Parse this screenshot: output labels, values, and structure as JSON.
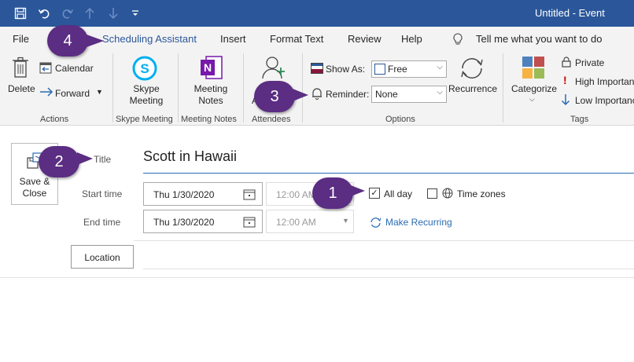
{
  "window": {
    "title": "Untitled  -  Event"
  },
  "quick_access": {
    "save_icon": "save-icon",
    "undo_icon": "undo-icon",
    "redo_icon": "redo-icon",
    "up_icon": "arrow-up-icon",
    "down_icon": "arrow-down-icon",
    "customize_icon": "customize-icon"
  },
  "tabs": [
    {
      "label": "File"
    },
    {
      "label": "Scheduling Assistant"
    },
    {
      "label": "Insert"
    },
    {
      "label": "Format Text"
    },
    {
      "label": "Review"
    },
    {
      "label": "Help"
    }
  ],
  "tell_me": {
    "text": "Tell me what you want to do"
  },
  "ribbon": {
    "actions": {
      "delete": "Delete",
      "calendar": "Calendar",
      "forward": "Forward",
      "group": "Actions"
    },
    "skype": {
      "line1": "Skype",
      "line2": "Meeting",
      "group": "Skype Meeting"
    },
    "notes": {
      "line1": "Meeting",
      "line2": "Notes",
      "group": "Meeting Notes"
    },
    "attendees": {
      "label": "A",
      "group": "Attendees"
    },
    "options": {
      "show_as_label": "Show As:",
      "show_as_value": "Free",
      "reminder_label": "Reminder:",
      "reminder_value": "None",
      "recurrence": "Recurrence",
      "group": "Options"
    },
    "tags": {
      "categorize": "Categorize",
      "private": "Private",
      "high": "High Importance",
      "low": "Low Importance",
      "group": "Tags"
    }
  },
  "form": {
    "save_close_line1": "Save &",
    "save_close_line2": "Close",
    "title_label": "Title",
    "title_value": "Scott in Hawaii",
    "start_label": "Start time",
    "start_date": "Thu 1/30/2020",
    "start_time": "12:00 AM",
    "end_label": "End time",
    "end_date": "Thu 1/30/2020",
    "end_time": "12:00 AM",
    "all_day_label": "All day",
    "all_day_checked": true,
    "time_zones_label": "Time zones",
    "make_recurring": "Make Recurring",
    "location_button": "Location"
  },
  "callouts": [
    "4",
    "3",
    "2",
    "1"
  ],
  "colors": {
    "title_bar": "#2b579a",
    "ribbon_bg": "#f3f3f3",
    "callout": "#5b2d83",
    "link": "#2b6cb0"
  }
}
